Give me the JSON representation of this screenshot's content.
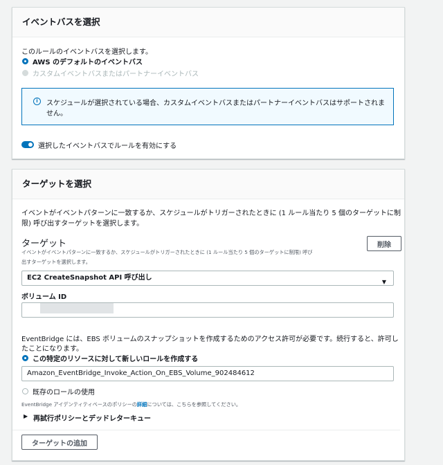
{
  "event_bus_panel": {
    "title": "イベントバスを選択",
    "description": "このルールのイベントバスを選択します。",
    "options": [
      {
        "label": "AWS のデフォルトのイベントバス",
        "selected": true,
        "disabled": false
      },
      {
        "label": "カスタムイベントバスまたはパートナーイベントバス",
        "selected": false,
        "disabled": true
      }
    ],
    "alert_line1": "スケジュールが選択されている場合、カスタムイベントバスまたはパートナーイベントバスはサポートされま",
    "alert_line2": "せん。",
    "toggle_label": "選択したイベントバスでルールを有効にする",
    "toggle_on": true
  },
  "target_panel": {
    "title": "ターゲットを選択",
    "description_line1": "イベントがイベントパターンに一致するか、スケジュールがトリガーされたときに (1 ルール当たり 5 個のターゲットに制",
    "description_line2": "限) 呼び出すターゲットを選択します。",
    "target_heading": "ターゲット",
    "target_help_line1": "イベントがイベントパターンに一致するか、スケジュールがトリガーされたときに (1 ルール当たり 5 個のターゲットに制限) 呼び",
    "target_help_line2": "出すターゲットを選択します。",
    "delete_button": "削除",
    "target_select_value": "EC2 CreateSnapshot API 呼び出し",
    "volume_id_label": "ボリューム ID",
    "permission_line1": "EventBridge には、EBS ボリュームのスナップショットを作成するためのアクセス許可が必要です。続行すると、許可し",
    "permission_line2": "たことになります。",
    "role_options": [
      {
        "label": "この特定のリソースに対して新しいロールを作成する",
        "selected": true
      },
      {
        "label": "既存のロールの使用",
        "selected": false
      }
    ],
    "role_name_value": "Amazon_EventBridge_Invoke_Action_On_EBS_Volume_902484612",
    "policy_text_before": "EventBridge アイデンティティベースのポリシーの",
    "policy_link": "詳細",
    "policy_text_after": "については、こちらを参照してください。",
    "retry_section": "再試行ポリシーとデッドレターキュー",
    "add_target_button": "ターゲットの追加"
  },
  "colors": {
    "accent": "#0073bb",
    "background": "#f2f3f3",
    "alert_background": "#f1faff"
  }
}
